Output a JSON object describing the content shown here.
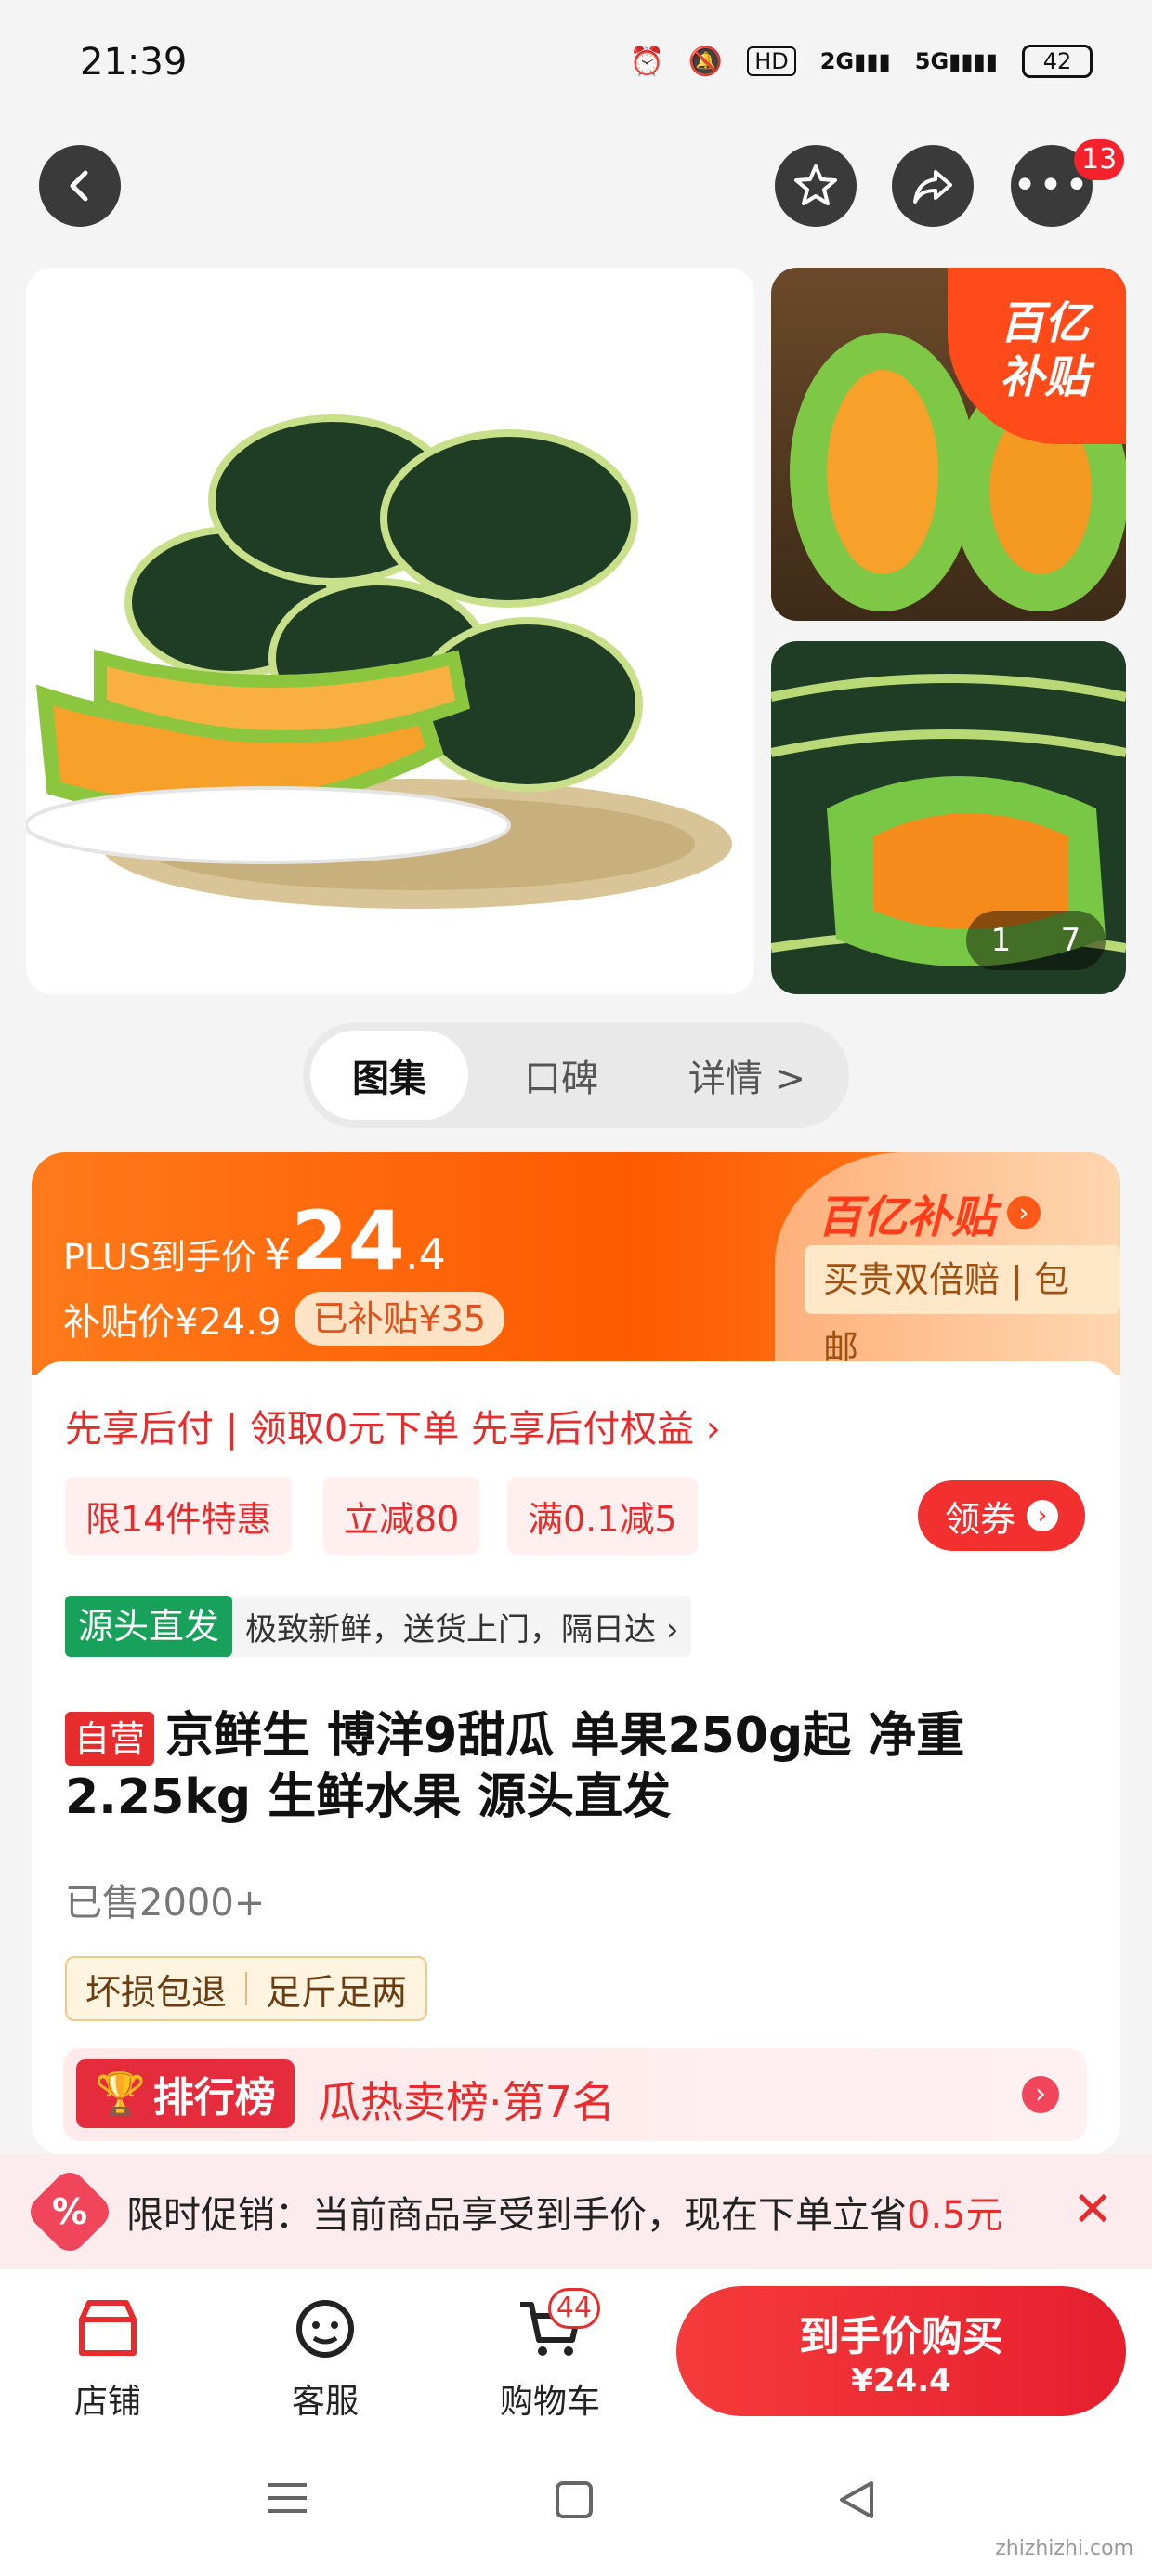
{
  "status_bar": {
    "time": "21:39",
    "network_left": "2G",
    "network_right": "5G",
    "battery": "42"
  },
  "header": {
    "more_badge": "13"
  },
  "gallery": {
    "subsidy_badge_line1": "百亿",
    "subsidy_badge_line2": "补贴",
    "page_current": "1",
    "page_total": "7"
  },
  "tabs": [
    {
      "label": "图集"
    },
    {
      "label": "口碑"
    },
    {
      "label": "详情 >"
    }
  ],
  "price": {
    "plus_label": "PLUS到手价",
    "currency": "¥",
    "plus_int": "24",
    "plus_dec": ".4",
    "subsidy_price_label": "补贴价¥24.9",
    "subsidized": "已补贴¥35",
    "brand": "百亿补贴",
    "guarantee": "买贵双倍赔 | 包邮"
  },
  "pay_later": {
    "text": "先享后付 | 领取0元下单 先享后付权益 ›"
  },
  "coupons": {
    "items": [
      "限14件特惠",
      "立减80",
      "满0.1减5"
    ],
    "claim": "领券"
  },
  "source": {
    "tag": "源头直发",
    "desc": "极致新鲜，送货上门，隔日达 ›"
  },
  "product": {
    "self_tag": "自营",
    "title_line1": "京鲜生 博洋9甜瓜 单果250g起 净重",
    "title_line2": "2.25kg 生鲜水果 源头直发",
    "sold": "已售2000+",
    "service_tags": [
      "坏损包退",
      "足斤足两"
    ]
  },
  "ranking": {
    "badge": "排行榜",
    "text": "瓜热卖榜·第7名"
  },
  "promo": {
    "text_prefix": "限时促销：当前商品享受到手价，现在下单立省",
    "amount": "0.5元"
  },
  "bottom_nav": {
    "items": [
      {
        "label": "店铺"
      },
      {
        "label": "客服"
      },
      {
        "label": "购物车"
      }
    ],
    "cart_badge": "44",
    "buy_label": "到手价购买",
    "buy_price": "¥24.4"
  },
  "watermark": "zhizhizhi.com",
  "colors": {
    "accent": "#e62c2c",
    "orange": "#ff5a00",
    "buy": "#f53b3b"
  }
}
